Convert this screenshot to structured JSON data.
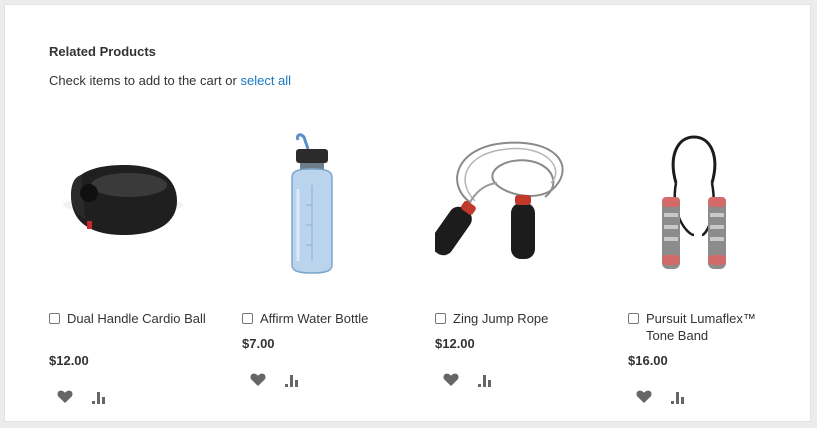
{
  "section": {
    "title": "Related Products",
    "subtitle_prefix": "Check items to add to the cart or ",
    "select_all": "select all"
  },
  "products": [
    {
      "name": "Dual Handle Cardio Ball",
      "price": "$12.00",
      "image_icon": "cardio-ball-image"
    },
    {
      "name": "Affirm Water Bottle",
      "price": "$7.00",
      "image_icon": "water-bottle-image"
    },
    {
      "name": "Zing Jump Rope",
      "price": "$12.00",
      "image_icon": "jump-rope-image"
    },
    {
      "name": "Pursuit Lumaflex™ Tone Band",
      "price": "$16.00",
      "image_icon": "tone-band-image"
    }
  ],
  "colors": {
    "link": "#1979c3",
    "icon": "#666666"
  }
}
